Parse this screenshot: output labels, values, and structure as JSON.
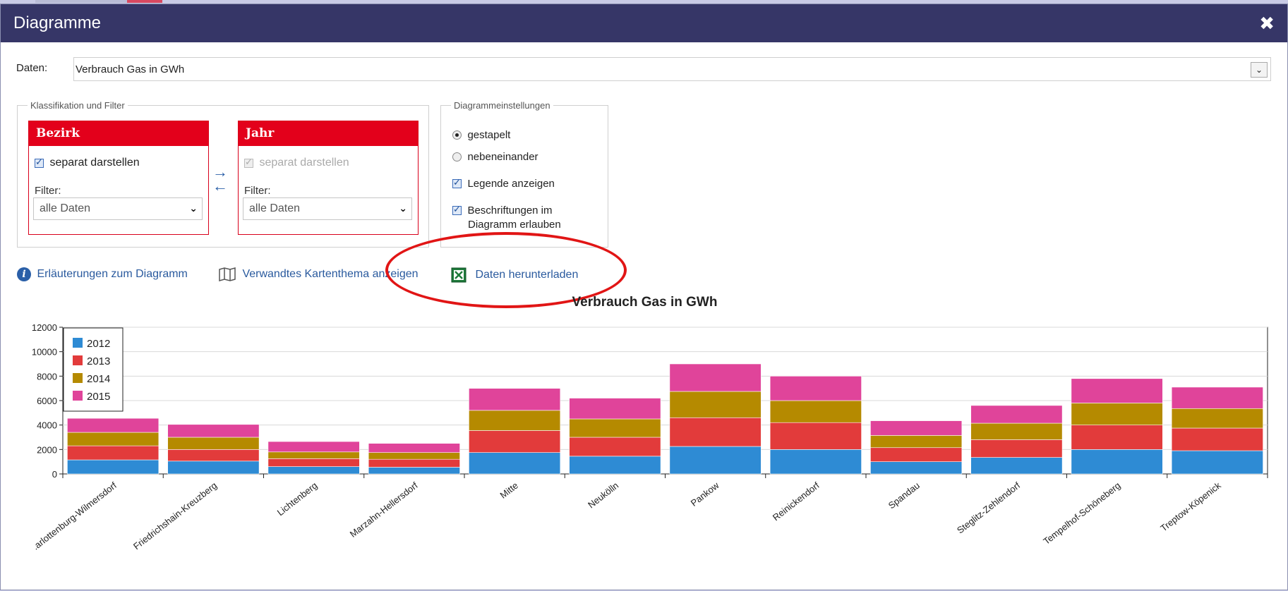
{
  "dialog": {
    "title": "Diagramme",
    "close_glyph": "✖"
  },
  "daten": {
    "label": "Daten:",
    "value": "Verbrauch Gas in GWh",
    "arrow_glyph": "⌄"
  },
  "klassifikation": {
    "legend": "Klassifikation und Filter",
    "bezirk": {
      "title": "Bezirk",
      "checkbox_label": "separat darstellen",
      "checked": true,
      "filter_label": "Filter:",
      "filter_value": "alle Daten"
    },
    "jahr": {
      "title": "Jahr",
      "checkbox_label": "separat darstellen",
      "checked": true,
      "disabled": true,
      "filter_label": "Filter:",
      "filter_value": "alle Daten"
    },
    "swap_icon": "swap-arrows-icon"
  },
  "diagrammeinstellungen": {
    "legend": "Diagrammeinstellungen",
    "options": [
      {
        "label": "gestapelt",
        "type": "radio",
        "checked": true
      },
      {
        "label": "nebeneinander",
        "type": "radio",
        "checked": false
      },
      {
        "label": "Legende anzeigen",
        "type": "checkbox",
        "checked": true
      },
      {
        "label": "Beschriftungen im",
        "label2": "Diagramm erlauben",
        "type": "checkbox",
        "checked": true
      }
    ]
  },
  "links": {
    "info": {
      "label": "Erläuterungen zum Diagramm",
      "icon": "info-icon"
    },
    "map": {
      "label": "Verwandtes Kartenthema anzeigen",
      "icon": "map-icon"
    },
    "download": {
      "label": "Daten herunterladen",
      "icon": "excel-icon"
    }
  },
  "colors": {
    "2012": "#2e8bd4",
    "2013": "#e23b3b",
    "2014": "#b58a00",
    "2015": "#e0449a",
    "header_red": "#e3001b",
    "titlebar": "#363667"
  },
  "chart_data": {
    "type": "bar",
    "stacked": true,
    "title": "Verbrauch Gas in GWh",
    "categories": [
      "Charlottenburg-Wilmersdorf",
      "Friedrichshain-Kreuzberg",
      "Lichtenberg",
      "Marzahn-Hellersdorf",
      "Mitte",
      "Neukölln",
      "Pankow",
      "Reinickendorf",
      "Spandau",
      "Steglitz-Zehlendorf",
      "Tempelhof-Schöneberg",
      "Treptow-Köpenick"
    ],
    "category_labels": [
      ".arlottenburg-Wilmersdorf",
      "Friedrichshain-Kreuzberg",
      "Lichtenberg",
      "Marzahn-Hellersdorf",
      "Mitte",
      "Neukölln",
      "Pankow",
      "Reinickendorf",
      "Spandau",
      "Steglitz-Zehlendorf",
      "Tempelhof-Schöneberg",
      "Treptow-Köpenick"
    ],
    "series": [
      {
        "name": "2012",
        "color": "#2e8bd4",
        "values": [
          1150,
          1050,
          600,
          550,
          1750,
          1450,
          2250,
          2000,
          1000,
          1350,
          2000,
          1900
        ]
      },
      {
        "name": "2013",
        "color": "#e23b3b",
        "values": [
          1150,
          950,
          650,
          650,
          1800,
          1550,
          2350,
          2200,
          1150,
          1450,
          2000,
          1850
        ]
      },
      {
        "name": "2014",
        "color": "#b58a00",
        "values": [
          1100,
          1000,
          550,
          550,
          1650,
          1500,
          2150,
          1800,
          1000,
          1350,
          1800,
          1600
        ]
      },
      {
        "name": "2015",
        "color": "#e0449a",
        "values": [
          1150,
          1050,
          850,
          750,
          1800,
          1700,
          2250,
          2000,
          1200,
          1450,
          2000,
          1750
        ]
      }
    ],
    "ylim": [
      0,
      12000
    ],
    "yticks": [
      0,
      2000,
      4000,
      6000,
      8000,
      10000,
      12000
    ],
    "grid": true,
    "legend": "top-left"
  }
}
